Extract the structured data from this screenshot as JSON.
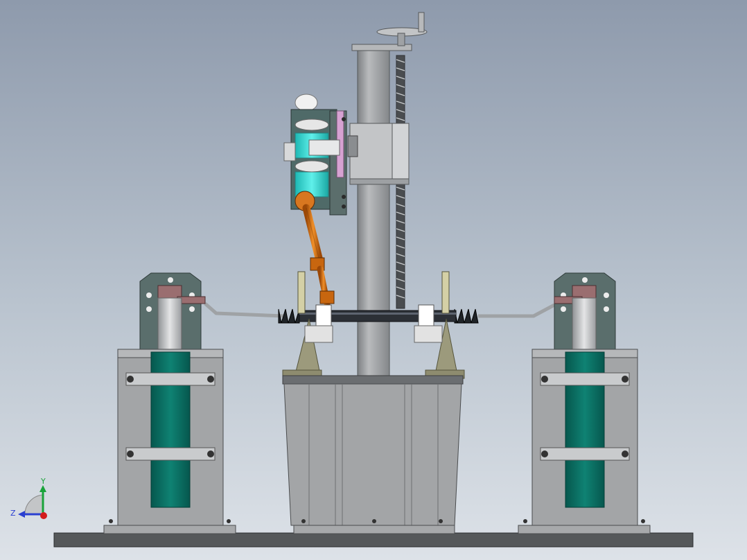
{
  "viewport": {
    "background_top": "#8e9aac",
    "background_bottom": "#dde2e8"
  },
  "colors": {
    "steel_gray": "#a3a5a7",
    "dark_gray": "#6c6f72",
    "teal_cylinder": "#0b7267",
    "slate_green": "#4f6a68",
    "cyan_coupling": "#34d6d2",
    "orange_shaft": "#c8660f",
    "olive_bracket": "#9c9a7c",
    "pink_plate": "#d6a2d2",
    "base_plate": "#55585a",
    "rack_bar": "#2c3036"
  },
  "triad": {
    "y_label": "Y",
    "z_label": "Z",
    "y_color": "#19a33a",
    "z_color": "#2a3fd1",
    "x_color": "#d31c1c"
  }
}
